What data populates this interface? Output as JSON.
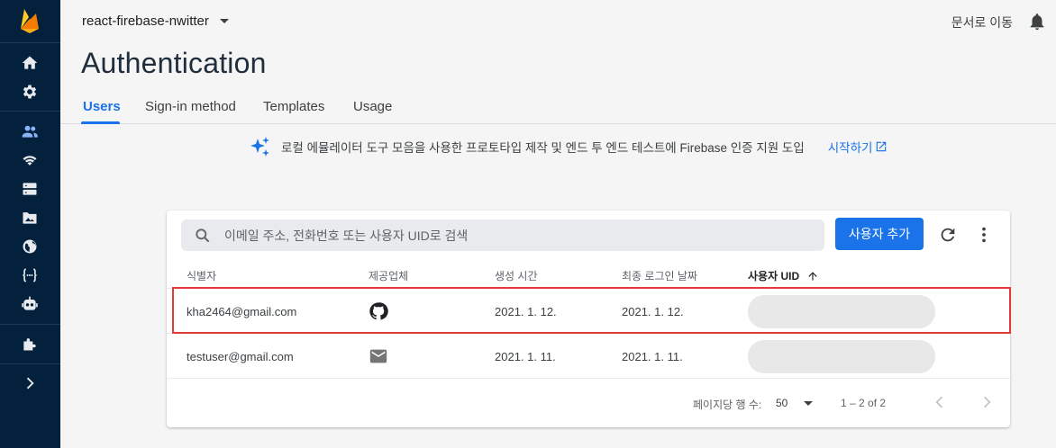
{
  "project": {
    "name": "react-firebase-nwitter"
  },
  "header": {
    "docs_label": "문서로 이동"
  },
  "page": {
    "title": "Authentication"
  },
  "tabs": [
    {
      "label": "Users"
    },
    {
      "label": "Sign-in method"
    },
    {
      "label": "Templates"
    },
    {
      "label": "Usage"
    }
  ],
  "promo": {
    "text": "로컬 에뮬레이터 도구 모음을 사용한 프로토타입 제작 및 엔드 투 엔드 테스트에 Firebase 인증 지원 도입",
    "link": "시작하기"
  },
  "search": {
    "placeholder": "이메일 주소, 전화번호 또는 사용자 UID로 검색"
  },
  "toolbar": {
    "add_user_label": "사용자 추가"
  },
  "table": {
    "columns": [
      "식별자",
      "제공업체",
      "생성 시간",
      "최종 로그인 날짜",
      "사용자 UID"
    ],
    "rows": [
      {
        "identifier": "kha2464@gmail.com",
        "provider": "github-icon",
        "created": "2021. 1. 12.",
        "last_login": "2021. 1. 12.",
        "uid": ""
      },
      {
        "identifier": "testuser@gmail.com",
        "provider": "email-icon",
        "created": "2021. 1. 11.",
        "last_login": "2021. 1. 11.",
        "uid": ""
      }
    ]
  },
  "pagination": {
    "per_page_label": "페이지당 행 수:",
    "per_page_value": "50",
    "range": "1 – 2 of 2"
  },
  "colors": {
    "sidebar": "#03203c",
    "accent": "#1a73e8",
    "highlight": "#e53935",
    "firebase_orange": "#ffa000"
  }
}
